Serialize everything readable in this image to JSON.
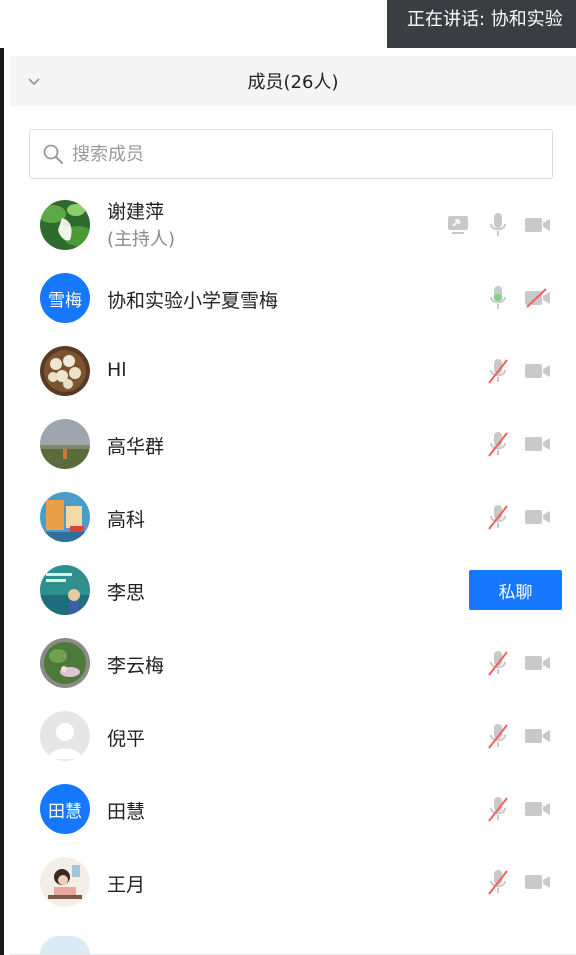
{
  "speaking_banner": "正在讲话: 协和实验",
  "panel": {
    "title": "成员(26人)"
  },
  "search": {
    "placeholder": "搜索成员"
  },
  "colors": {
    "accent": "#1677ff",
    "mic_active": "#7ed37e",
    "muted_red": "#f26060",
    "icon_gray": "#c9c9c9",
    "banner_bg": "#3a3d42"
  },
  "members": [
    {
      "name": "谢建萍",
      "role": "(主持人)",
      "avatar": "photo-green-leaf",
      "icons": [
        "screen-share-icon",
        "microphone-icon",
        "camera-icon"
      ]
    },
    {
      "name": "协和实验小学夏雪梅",
      "avatar_text": "雪梅",
      "icons": [
        "microphone-active-icon",
        "camera-off-icon"
      ]
    },
    {
      "name": "Hl",
      "avatar": "photo-dumplings",
      "icons": [
        "microphone-muted-icon",
        "camera-icon"
      ]
    },
    {
      "name": "高华群",
      "avatar": "photo-landscape",
      "icons": [
        "microphone-muted-icon",
        "camera-icon"
      ]
    },
    {
      "name": "高科",
      "avatar": "photo-blue-art",
      "icons": [
        "microphone-muted-icon",
        "camera-icon"
      ]
    },
    {
      "name": "李思",
      "avatar": "photo-teal-art",
      "action": "私聊"
    },
    {
      "name": "李云梅",
      "avatar": "photo-garden",
      "icons": [
        "microphone-muted-icon",
        "camera-icon"
      ]
    },
    {
      "name": "倪平",
      "avatar": "default-person",
      "icons": [
        "microphone-muted-icon",
        "camera-icon"
      ]
    },
    {
      "name": "田慧",
      "avatar_text": "田慧",
      "icons": [
        "microphone-muted-icon",
        "camera-icon"
      ]
    },
    {
      "name": "王月",
      "avatar": "photo-cartoon-reading",
      "icons": [
        "microphone-muted-icon",
        "camera-icon"
      ]
    }
  ]
}
